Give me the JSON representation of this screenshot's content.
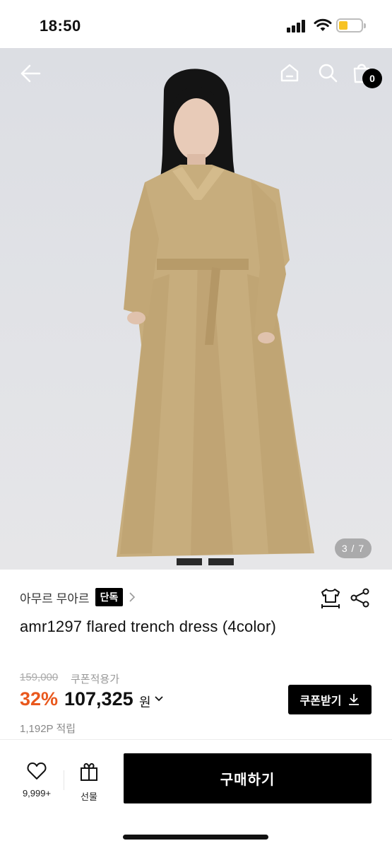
{
  "status_bar": {
    "time": "18:50",
    "battery_color": "#f7c325",
    "icons": [
      "signal-icon",
      "wifi-icon",
      "battery-icon"
    ]
  },
  "hero": {
    "icons": [
      "back-arrow-icon",
      "home-icon",
      "search-icon",
      "shopping-bag-icon"
    ],
    "cart_count": "0",
    "pager": "3 / 7"
  },
  "product": {
    "brand": "아무르 무아르",
    "exclusive_badge": "단독",
    "title": "amr1297 flared trench dress (4color)",
    "original_price": "159,000",
    "coupon_price_label": "쿠폰적용가",
    "discount": "32%",
    "price": "107,325",
    "price_unit": "원",
    "coupon_button": "쿠폰받기",
    "points": "1,192P 적립",
    "accent_color": "#e9581d"
  },
  "bottom_bar": {
    "wish_count": "9,999+",
    "gift_label": "선물",
    "buy_label": "구매하기"
  }
}
